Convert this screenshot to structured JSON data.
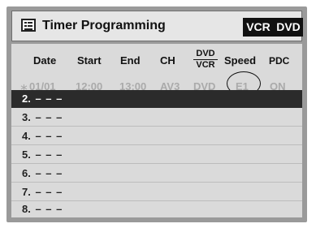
{
  "header": {
    "title": "Timer Programming",
    "icon": "menu-list-icon",
    "badges": [
      "VCR",
      "DVD"
    ]
  },
  "columns": {
    "date": "Date",
    "start": "Start",
    "end": "End",
    "ch": "CH",
    "dvd": "DVD",
    "vcr": "VCR",
    "speed": "Speed",
    "pdc": "PDC"
  },
  "program1": {
    "marker": "∗",
    "date": "01/01",
    "start": "12:00",
    "end": "13:00",
    "ch": "AV3",
    "media": "DVD",
    "speed": "E1",
    "pdc": "ON"
  },
  "rows": [
    {
      "num": "2.",
      "dash": "– – –"
    },
    {
      "num": "3.",
      "dash": "– – –"
    },
    {
      "num": "4.",
      "dash": "– – –"
    },
    {
      "num": "5.",
      "dash": "– – –"
    },
    {
      "num": "6.",
      "dash": "– – –"
    },
    {
      "num": "7.",
      "dash": "– – –"
    },
    {
      "num": "8.",
      "dash": "– – –"
    }
  ],
  "colors": {
    "frame": "#9a9a9a",
    "panel": "#dadada",
    "selected_row": "#2b2b2b",
    "inactive_text": "#aaaaaa"
  }
}
